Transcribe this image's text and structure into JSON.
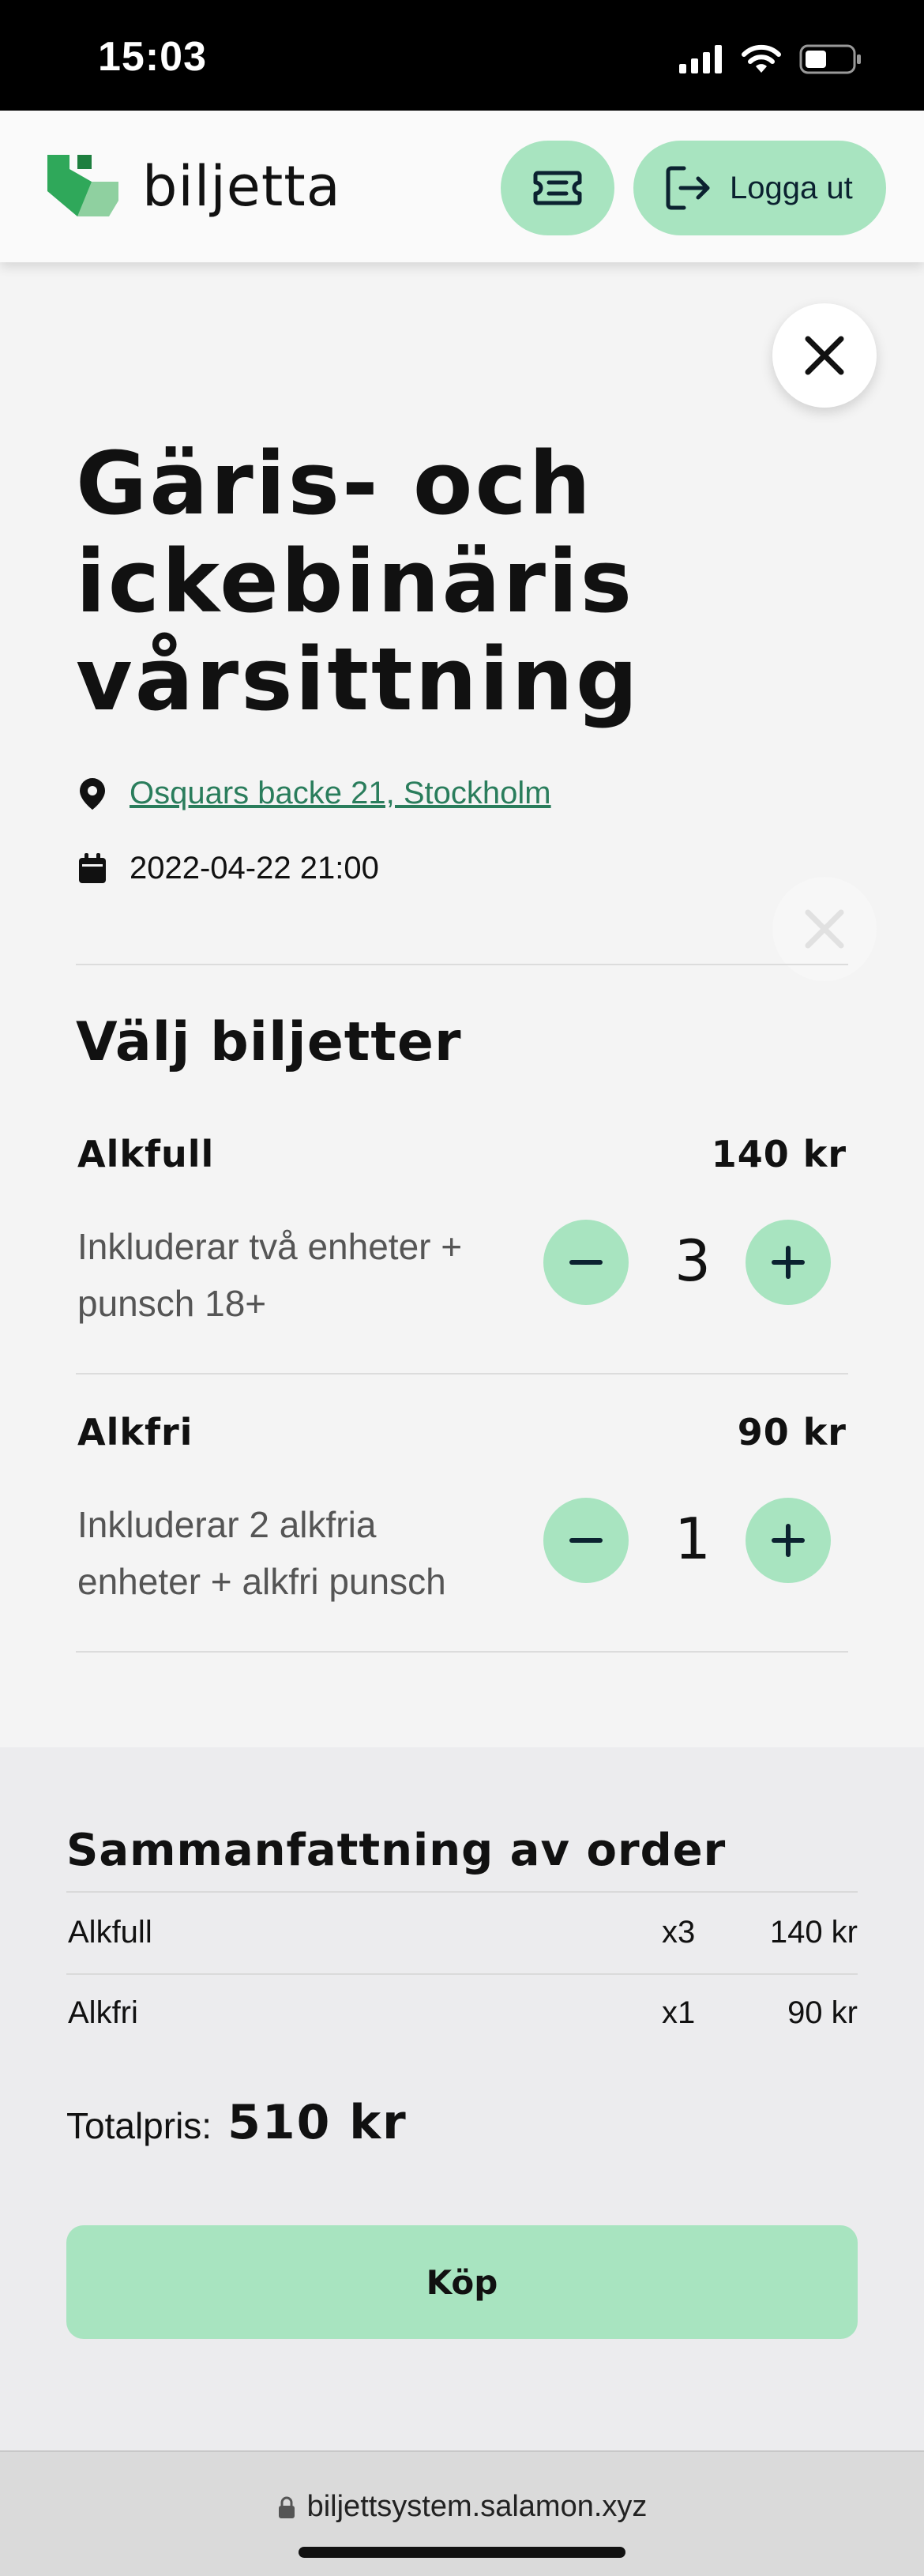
{
  "status_bar": {
    "time": "15:03"
  },
  "header": {
    "logo_text": "biljetta",
    "logout_label": "Logga ut"
  },
  "event": {
    "title": "Gäris- och ickebinäris vårsittning",
    "location": "Osquars backe 21, Stockholm",
    "datetime": "2022-04-22 21:00"
  },
  "tickets": {
    "section_title": "Välj biljetter",
    "items": [
      {
        "name": "Alkfull",
        "price": "140 kr",
        "description": "Inkluderar två enheter + punsch 18+",
        "quantity": "3"
      },
      {
        "name": "Alkfri",
        "price": "90 kr",
        "description": "Inkluderar 2 alkfria enheter + alkfri punsch",
        "quantity": "1"
      }
    ]
  },
  "summary": {
    "title": "Sammanfattning av order",
    "rows": [
      {
        "name": "Alkfull",
        "count": "x3",
        "price": "140 kr"
      },
      {
        "name": "Alkfri",
        "count": "x1",
        "price": "90 kr"
      }
    ],
    "total_label": "Totalpris:",
    "total_value": "510 kr",
    "buy_label": "Köp"
  },
  "browser": {
    "url": "biljettsystem.salamon.xyz"
  },
  "colors": {
    "accent": "#a8e4c0",
    "link": "#2a7d5c",
    "logo_green": "#2fa85a",
    "logo_light": "#8fd0a0"
  },
  "icons": [
    "signal-icon",
    "wifi-icon",
    "battery-icon",
    "ticket-icon",
    "logout-icon",
    "close-icon",
    "location-pin-icon",
    "calendar-icon",
    "minus-icon",
    "plus-icon",
    "lock-icon"
  ]
}
